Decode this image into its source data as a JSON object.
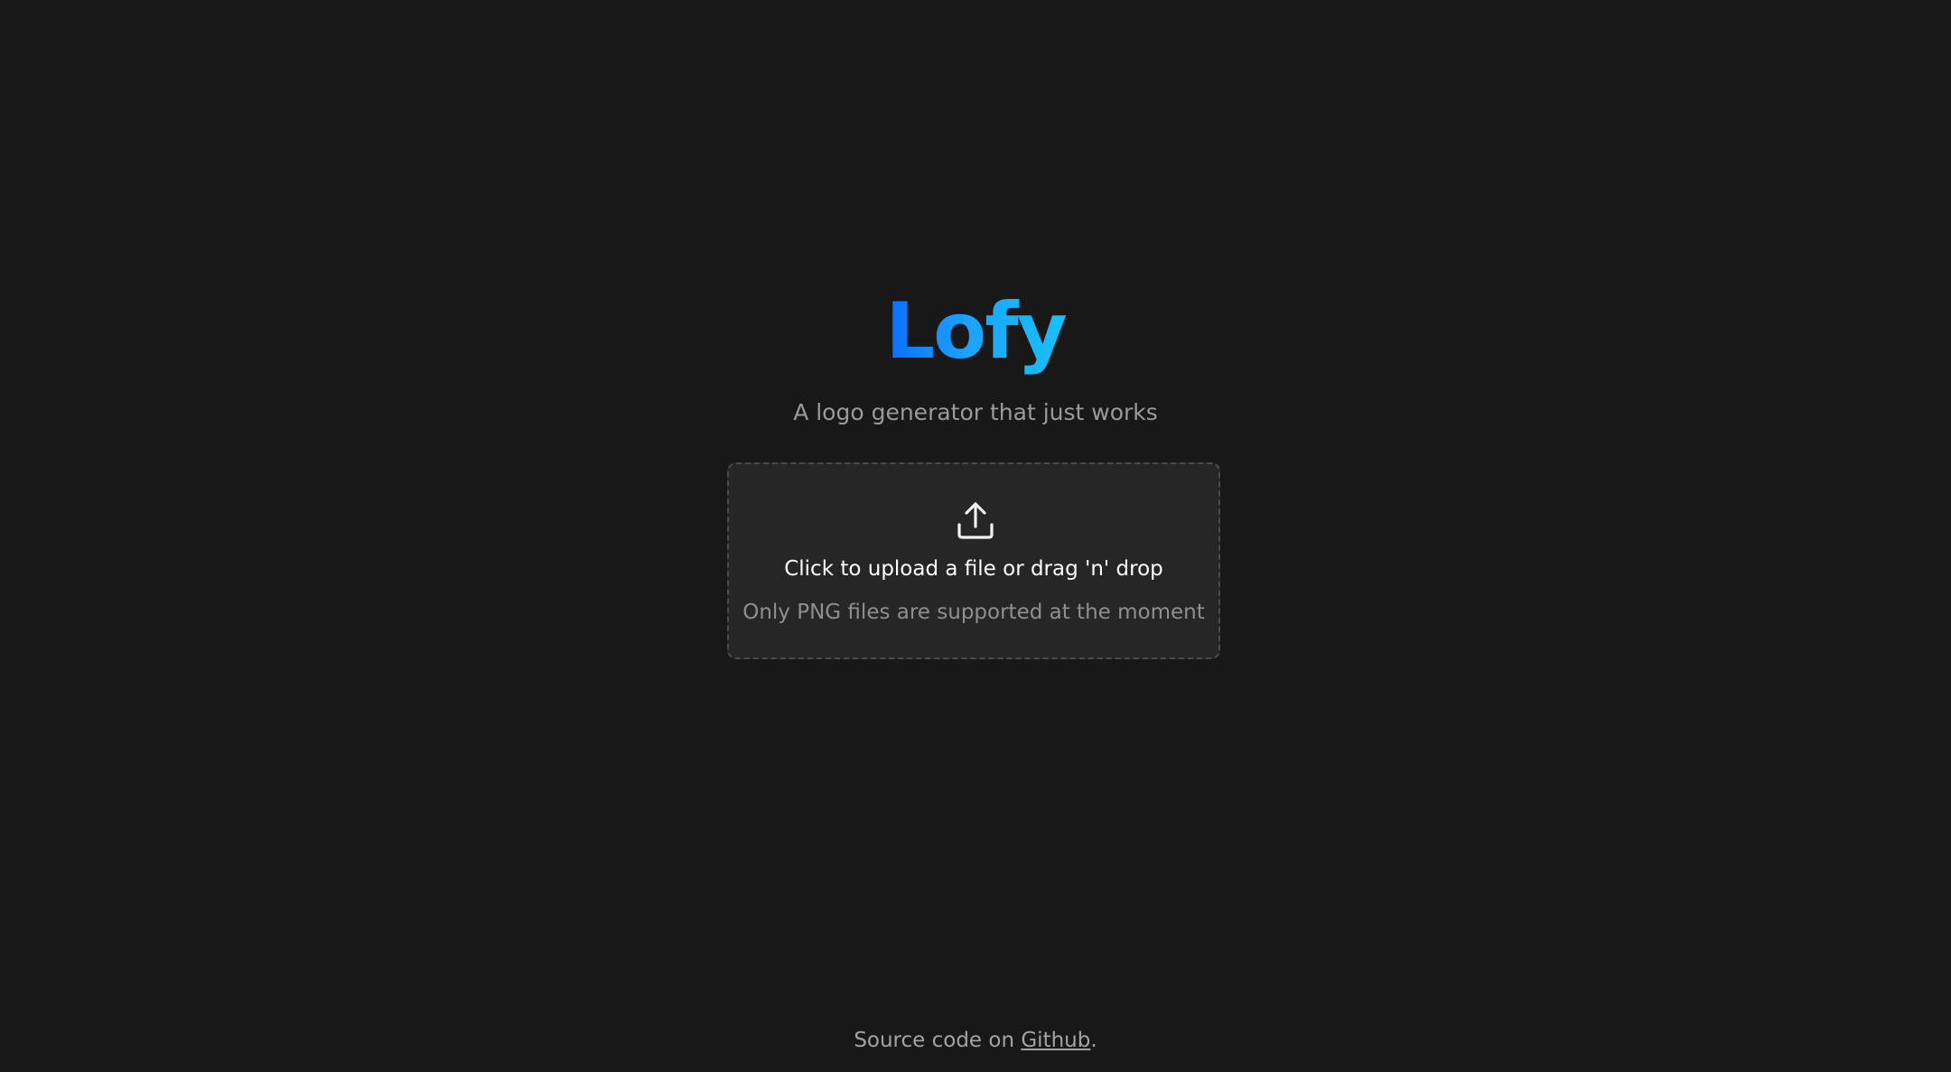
{
  "brand": {
    "title": "Lofy",
    "tagline": "A logo generator that just works",
    "gradient": [
      "#0a6cff",
      "#17c2f5"
    ]
  },
  "upload": {
    "icon": "upload-icon",
    "title": "Click to upload a file or drag 'n' drop",
    "hint": "Only PNG files are supported at the moment"
  },
  "footer": {
    "prefix": "Source code on ",
    "link_label": "Github",
    "suffix": "."
  },
  "colors": {
    "background": "#181818",
    "card": "#262626",
    "card_border": "#4a4a4a",
    "muted_text": "#9a9a9a"
  }
}
